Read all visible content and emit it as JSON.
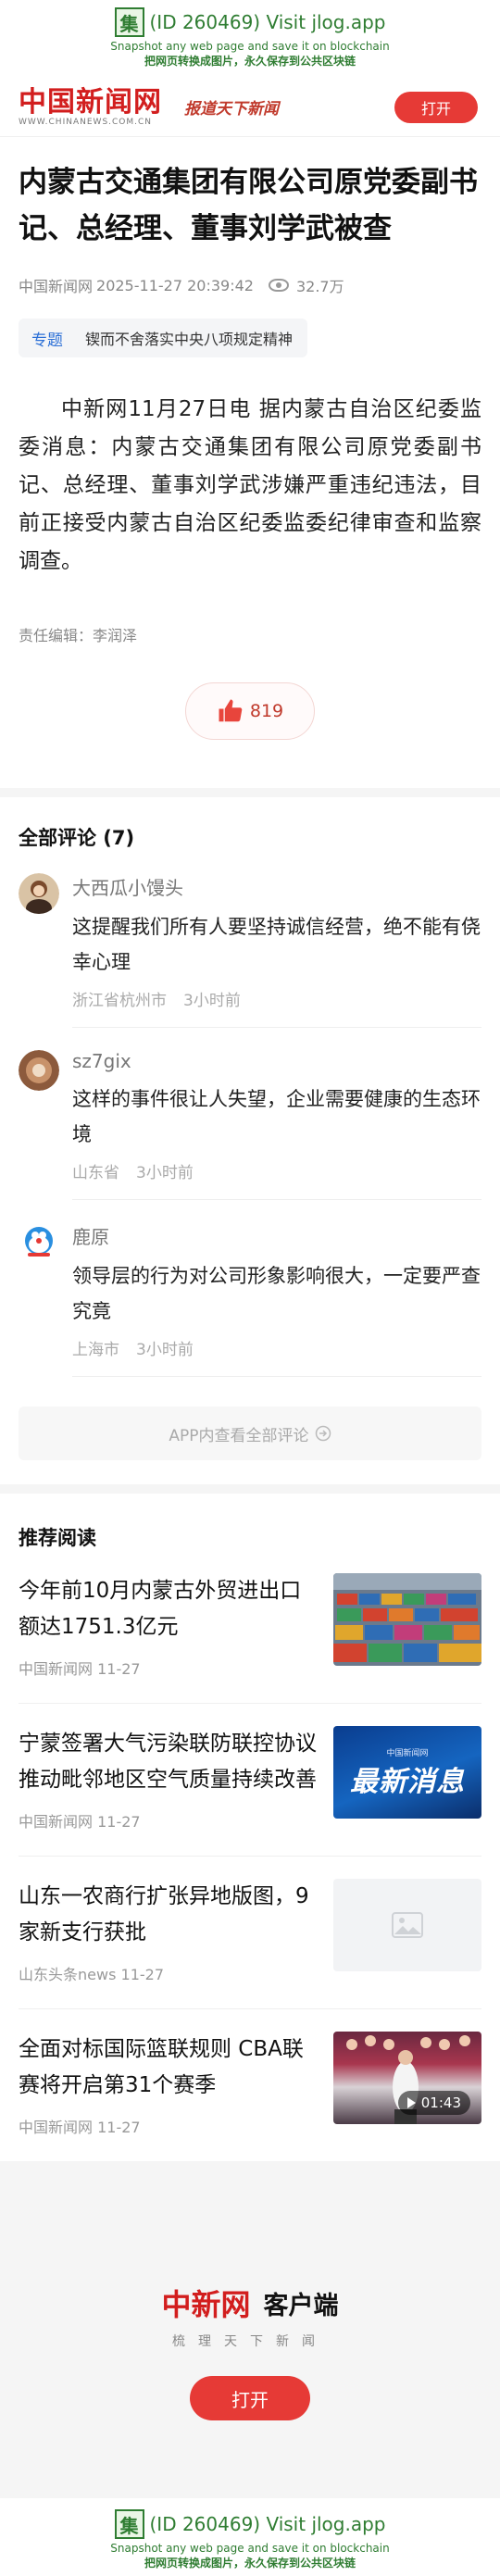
{
  "jlog_top": {
    "logo": "集",
    "id_text": "(ID 260469) Visit jlog.app",
    "line1": "Snapshot any web page and save it on blockchain",
    "line2": "把网页转换成图片，永久保存到公共区块链"
  },
  "header": {
    "brand_cn": "中国新闻网",
    "brand_en": "WWW.CHINANEWS.COM.CN",
    "slogan": "报道天下新闻",
    "open_label": "打开"
  },
  "article": {
    "title": "内蒙古交通集团有限公司原党委副书记、总经理、董事刘学武被查",
    "source": "中国新闻网",
    "time": "2025-11-27 20:39:42",
    "views": "32.7万",
    "topic_tag": "专题",
    "topic_text": "锲而不舍落实中央八项规定精神",
    "body": "中新网11月27日电 据内蒙古自治区纪委监委消息：内蒙古交通集团有限公司原党委副书记、总经理、董事刘学武涉嫌严重违纪违法，目前正接受内蒙古自治区纪委监委纪律审查和监察调查。",
    "editor": "责任编辑：李润泽",
    "likes": "819"
  },
  "comments": {
    "section_title": "全部评论 (7)",
    "items": [
      {
        "name": "大西瓜小馒头",
        "text": "这提醒我们所有人要坚持诚信经营，绝不能有侥幸心理",
        "location": "浙江省杭州市",
        "time": "3小时前"
      },
      {
        "name": "sz7gix",
        "text": "这样的事件很让人失望，企业需要健康的生态环境",
        "location": "山东省",
        "time": "3小时前"
      },
      {
        "name": "鹿原",
        "text": "领导层的行为对公司形象影响很大，一定要严查究竟",
        "location": "上海市",
        "time": "3小时前"
      }
    ],
    "view_all": "APP内查看全部评论"
  },
  "recommend": {
    "section_title": "推荐阅读",
    "items": [
      {
        "title": "今年前10月内蒙古外贸进出口额达1751.3亿元",
        "source": "中国新闻网",
        "date": "11-27"
      },
      {
        "title": "宁蒙签署大气污染联防联控协议 推动毗邻地区空气质量持续改善",
        "source": "中国新闻网",
        "date": "11-27",
        "image_text": "最新消息",
        "image_small": "中国新闻网"
      },
      {
        "title": "山东一农商行扩张异地版图，9家新支行获批",
        "source": "山东头条news",
        "date": "11-27"
      },
      {
        "title": "全面对标国际篮联规则 CBA联赛将开启第31个赛季",
        "source": "中国新闻网",
        "date": "11-27",
        "video_duration": "01:43"
      }
    ]
  },
  "footer": {
    "logo": "中新网",
    "client": "客户端",
    "slogan": "梳理天下新闻",
    "open_label": "打开"
  },
  "jlog_bottom": {
    "logo": "集",
    "id_text": "(ID 260469) Visit jlog.app",
    "line1": "Snapshot any web page and save it on blockchain",
    "line2": "把网页转换成图片，永久保存到公共区块链"
  },
  "colors": {
    "brand_red": "#e63a36",
    "link_blue": "#2b6fd6",
    "jlog_green": "#2f7d32"
  }
}
